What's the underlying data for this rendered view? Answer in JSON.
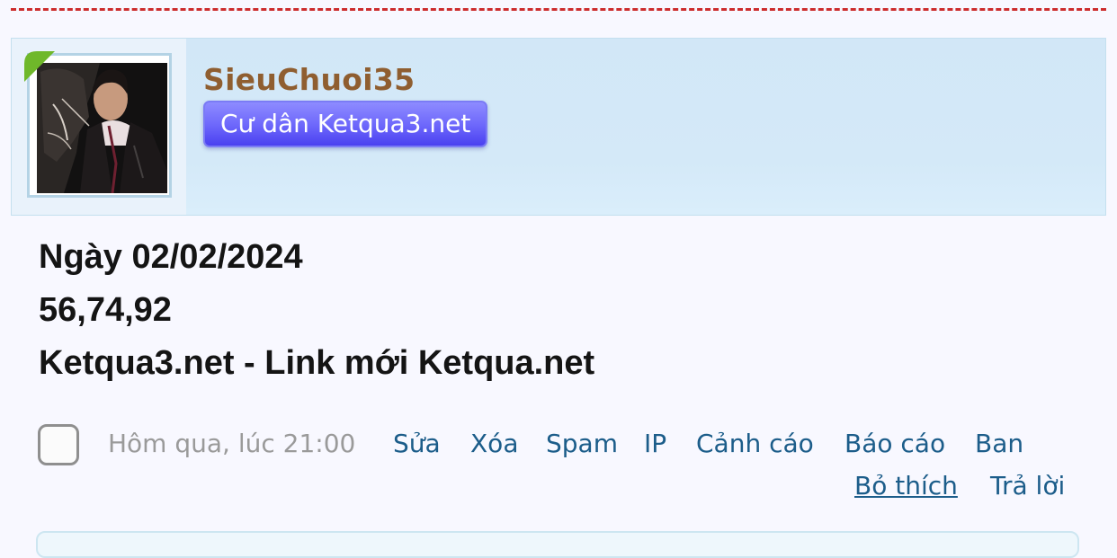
{
  "user": {
    "name": "SieuChuoi35",
    "title": "Cư dân Ketqua3.net"
  },
  "message": {
    "lines": [
      "Ngày 02/02/2024",
      "56,74,92",
      "Ketqua3.net - Link mới Ketqua.net"
    ]
  },
  "post_footer": {
    "timestamp": "Hôm qua, lúc 21:00",
    "actions": {
      "edit": "Sửa",
      "delete": "Xóa",
      "spam": "Spam",
      "ip": "IP",
      "warn": "Cảnh cáo",
      "report": "Báo cáo",
      "ban": "Ban",
      "unlike": "Bỏ thích",
      "reply": "Trả lời"
    }
  },
  "colors": {
    "username": "#8f5e30",
    "title_badge": "#5a54f8",
    "link": "#1c5d8a",
    "separator": "#cc2c2c",
    "online_indicator": "#6fb82a"
  }
}
